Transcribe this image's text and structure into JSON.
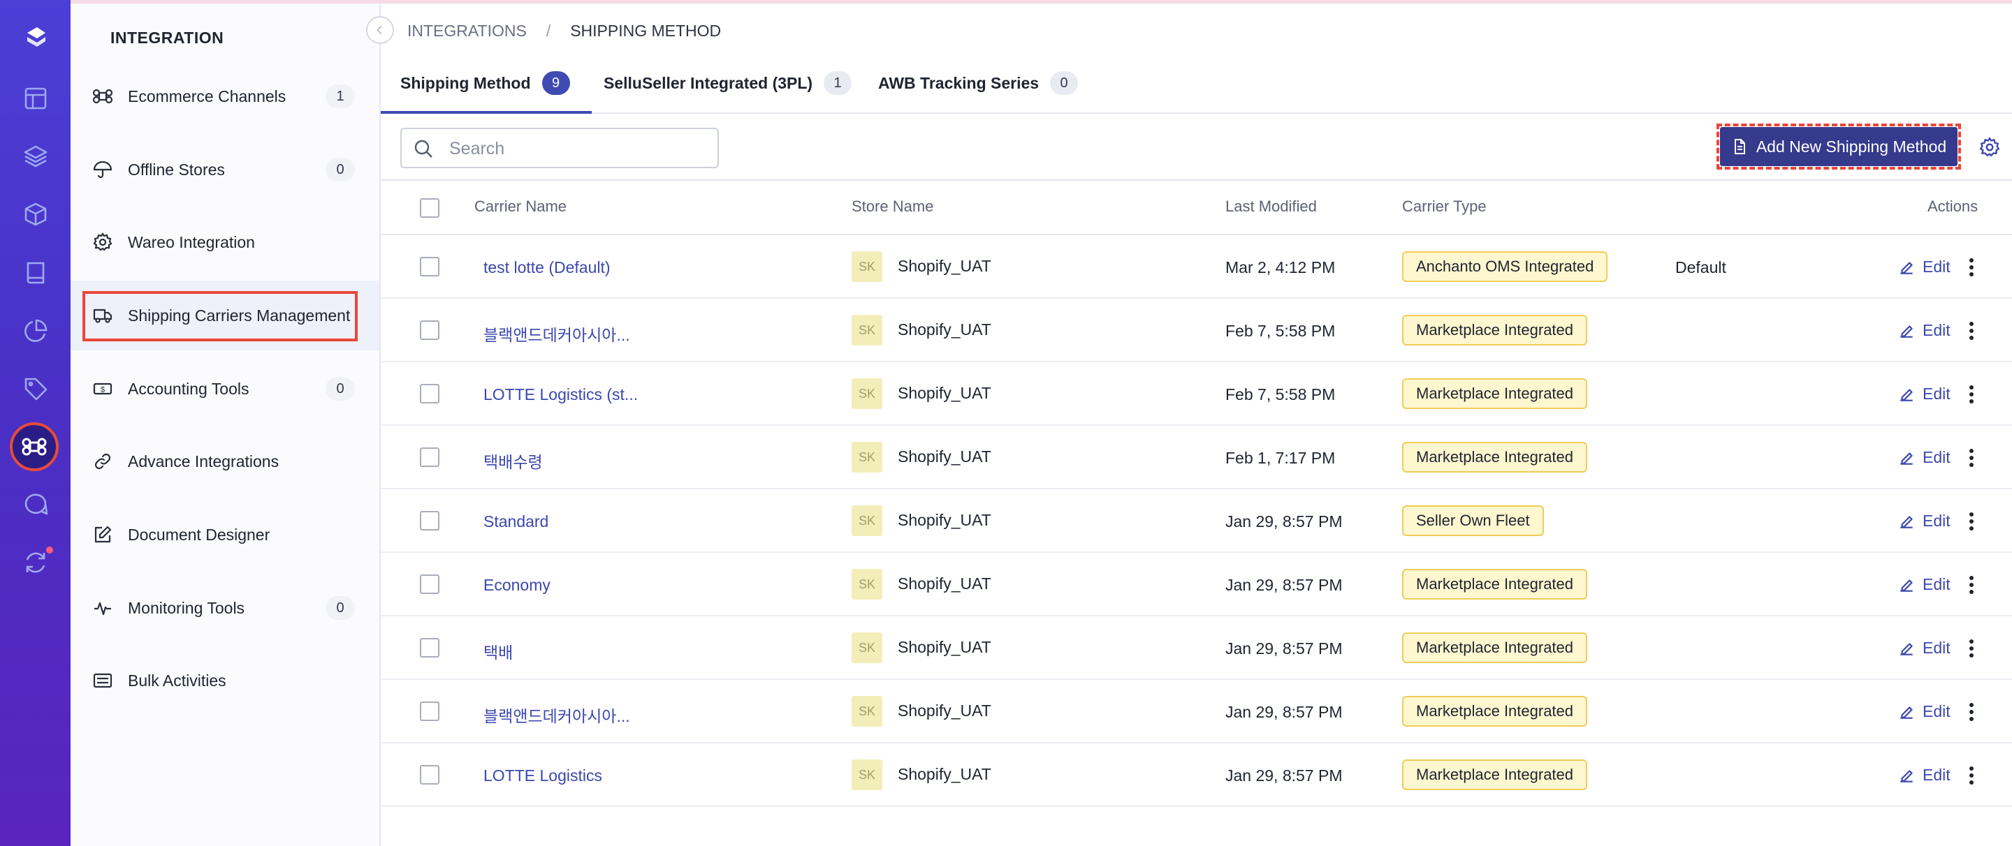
{
  "sidebar": {
    "title": "INTEGRATION",
    "items": [
      {
        "label": "Ecommerce Channels",
        "count": "1",
        "icon": "command-icon"
      },
      {
        "label": "Offline Stores",
        "count": "0",
        "icon": "umbrella-icon"
      },
      {
        "label": "Wareo Integration",
        "count": "",
        "icon": "gear-icon"
      },
      {
        "label": "Shipping Carriers Management",
        "count": "",
        "icon": "truck-icon"
      },
      {
        "label": "Accounting Tools",
        "count": "0",
        "icon": "dollar-bill-icon"
      },
      {
        "label": "Advance Integrations",
        "count": "",
        "icon": "link-icon"
      },
      {
        "label": "Document Designer",
        "count": "",
        "icon": "edit-square-icon"
      },
      {
        "label": "Monitoring Tools",
        "count": "0",
        "icon": "activity-icon"
      },
      {
        "label": "Bulk Activities",
        "count": "",
        "icon": "list-box-icon"
      }
    ]
  },
  "breadcrumb": {
    "root": "INTEGRATIONS",
    "separator": "/",
    "current": "SHIPPING METHOD"
  },
  "tabs": [
    {
      "label": "Shipping Method",
      "count": "9"
    },
    {
      "label": "SelluSeller Integrated (3PL)",
      "count": "1"
    },
    {
      "label": "AWB Tracking Series",
      "count": "0"
    }
  ],
  "toolbar": {
    "search_placeholder": "Search",
    "add_label": "Add New Shipping Method"
  },
  "table": {
    "headers": {
      "carrier": "Carrier Name",
      "store": "Store Name",
      "modified": "Last Modified",
      "type": "Carrier Type",
      "actions": "Actions"
    },
    "edit_label": "Edit",
    "rows": [
      {
        "carrier": "test lotte (Default)",
        "store_initials": "SK",
        "store": "Shopify_UAT",
        "modified": "Mar 2, 4:12 PM",
        "type": "Anchanto OMS Integrated",
        "default": "Default"
      },
      {
        "carrier": "블랙앤드데커아시아...",
        "store_initials": "SK",
        "store": "Shopify_UAT",
        "modified": "Feb 7, 5:58 PM",
        "type": "Marketplace Integrated",
        "default": ""
      },
      {
        "carrier": "LOTTE Logistics (st...",
        "store_initials": "SK",
        "store": "Shopify_UAT",
        "modified": "Feb 7, 5:58 PM",
        "type": "Marketplace Integrated",
        "default": ""
      },
      {
        "carrier": "택배수령",
        "store_initials": "SK",
        "store": "Shopify_UAT",
        "modified": "Feb 1, 7:17 PM",
        "type": "Marketplace Integrated",
        "default": ""
      },
      {
        "carrier": "Standard",
        "store_initials": "SK",
        "store": "Shopify_UAT",
        "modified": "Jan 29, 8:57 PM",
        "type": "Seller Own Fleet",
        "default": ""
      },
      {
        "carrier": "Economy",
        "store_initials": "SK",
        "store": "Shopify_UAT",
        "modified": "Jan 29, 8:57 PM",
        "type": "Marketplace Integrated",
        "default": ""
      },
      {
        "carrier": "택배",
        "store_initials": "SK",
        "store": "Shopify_UAT",
        "modified": "Jan 29, 8:57 PM",
        "type": "Marketplace Integrated",
        "default": ""
      },
      {
        "carrier": "블랙앤드데커아시아...",
        "store_initials": "SK",
        "store": "Shopify_UAT",
        "modified": "Jan 29, 8:57 PM",
        "type": "Marketplace Integrated",
        "default": ""
      },
      {
        "carrier": "LOTTE Logistics",
        "store_initials": "SK",
        "store": "Shopify_UAT",
        "modified": "Jan 29, 8:57 PM",
        "type": "Marketplace Integrated",
        "default": ""
      }
    ]
  },
  "colors": {
    "accent": "#3f4bb3",
    "highlight": "#e8463a",
    "badge_border": "#f0cd58"
  }
}
